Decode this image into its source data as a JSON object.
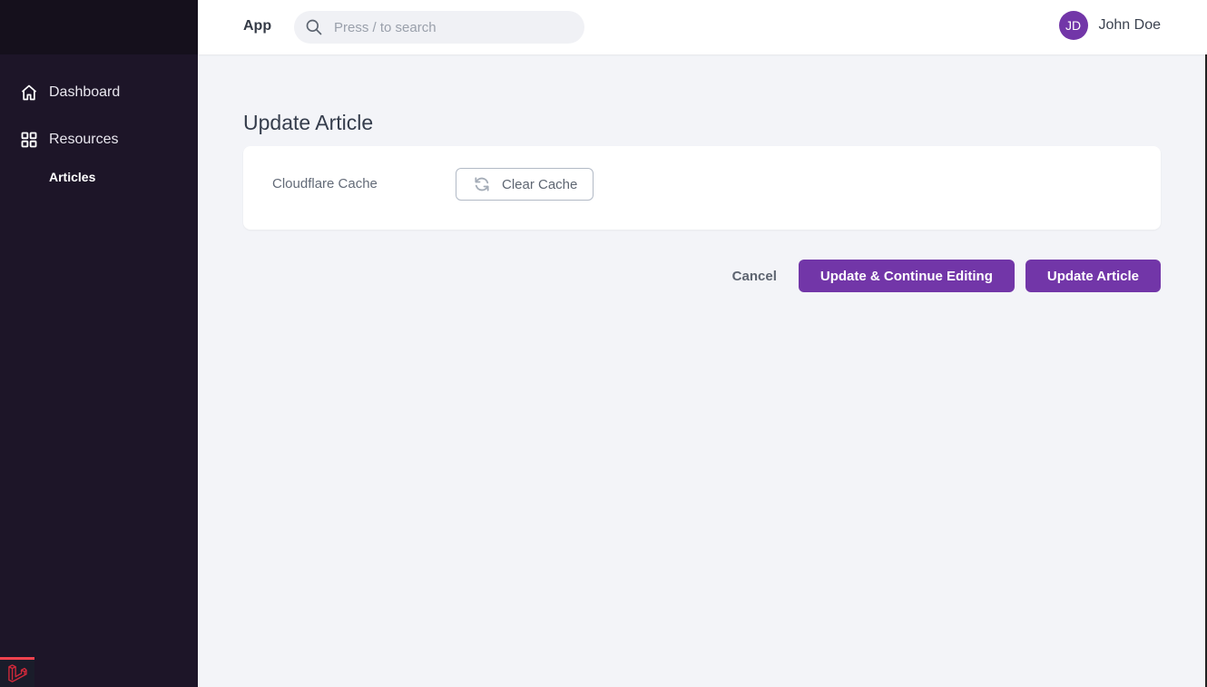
{
  "sidebar": {
    "items": [
      {
        "label": "Dashboard",
        "icon": "home-icon"
      },
      {
        "label": "Resources",
        "icon": "grid-icon"
      }
    ],
    "sub_items": [
      {
        "label": "Articles"
      }
    ]
  },
  "header": {
    "app_name": "App",
    "search_placeholder": "Press / to search",
    "search_value": "",
    "user_initials": "JD",
    "user_name": "John Doe"
  },
  "main": {
    "title": "Update Article",
    "fields": [
      {
        "label": "Cloudflare Cache",
        "button_label": "Clear Cache",
        "button_icon": "refresh-icon"
      }
    ],
    "actions": {
      "cancel": "Cancel",
      "update_continue": "Update & Continue Editing",
      "update": "Update Article"
    }
  },
  "colors": {
    "primary": "#7236a8",
    "sidebar_bg": "#1d1528",
    "page_bg": "#f3f4f8"
  }
}
